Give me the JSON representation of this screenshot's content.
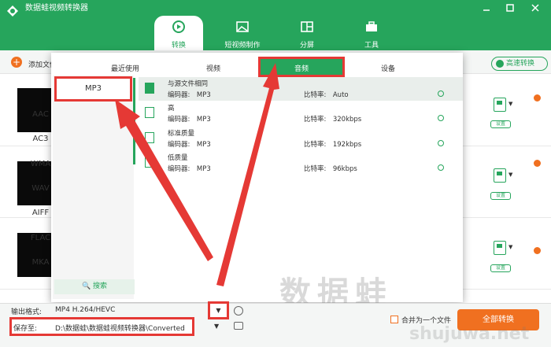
{
  "app": {
    "title": "数据蛙视频转换器"
  },
  "nav": [
    {
      "label": "转换"
    },
    {
      "label": "短视频制作"
    },
    {
      "label": "分屏"
    },
    {
      "label": "工具"
    }
  ],
  "toolbar": {
    "add_file": "添加文件",
    "speed_convert": "高速转换"
  },
  "panel": {
    "tabs": [
      "最近使用",
      "视频",
      "音频",
      "设备"
    ],
    "active_tab": "音频",
    "formats": [
      "MP3",
      "AAC",
      "AC3",
      "WMA",
      "WAV",
      "AIFF",
      "FLAC",
      "MKA"
    ],
    "selected_format": "MP3",
    "search_label": "搜索",
    "options": [
      {
        "name": "与源文件相同",
        "encoder": "编码器:　MP3",
        "bitrate": "比特率:　Auto"
      },
      {
        "name": "高",
        "encoder": "编码器:　MP3",
        "bitrate": "比特率:　320kbps"
      },
      {
        "name": "标准质量",
        "encoder": "编码器:　MP3",
        "bitrate": "比特率:　192kbps"
      },
      {
        "name": "低质量",
        "encoder": "编码器:　MP3",
        "bitrate": "比特率:　96kbps"
      }
    ]
  },
  "rows": [
    {
      "format": "MP4",
      "settings": "设置"
    },
    {
      "format": "MP4",
      "settings": "设置"
    },
    {
      "format": "MP4",
      "settings": "设置"
    }
  ],
  "bottom": {
    "output_format_label": "输出格式:",
    "output_format_value": "MP4 H.264/HEVC",
    "save_label": "保存至:",
    "save_path": "D:\\数据蛙\\数据蛙视频转换器\\Converted",
    "merge_label": "合并为一个文件",
    "convert_all": "全部转换"
  },
  "watermark": {
    "text": "数据蛙",
    "url": "shujuwa.net"
  },
  "colors": {
    "brand": "#26a55c",
    "accent": "#f07020",
    "highlight": "#e53935"
  }
}
